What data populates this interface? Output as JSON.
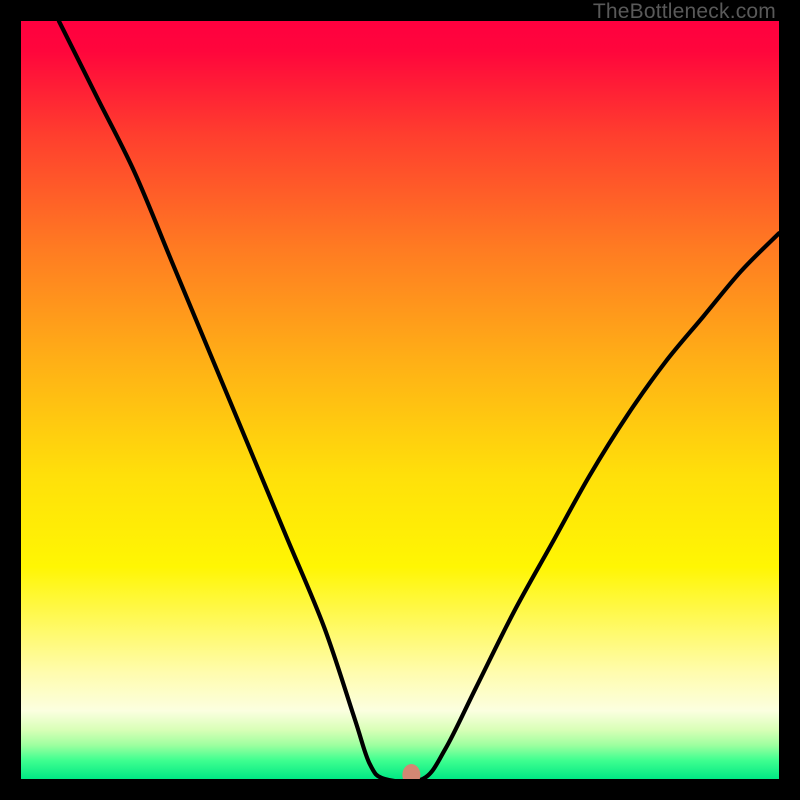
{
  "watermark": "TheBottleneck.com",
  "chart_data": {
    "type": "line",
    "title": "",
    "xlabel": "",
    "ylabel": "",
    "xlim": [
      0,
      100
    ],
    "ylim": [
      0,
      100
    ],
    "description": "Bottleneck magnitude curve: high on both edges, dips near zero around x≈51 (optimal point marked in salmon).",
    "curve": [
      {
        "x": 5,
        "y": 100
      },
      {
        "x": 10,
        "y": 90
      },
      {
        "x": 15,
        "y": 80
      },
      {
        "x": 20,
        "y": 68
      },
      {
        "x": 25,
        "y": 56
      },
      {
        "x": 30,
        "y": 44
      },
      {
        "x": 35,
        "y": 32
      },
      {
        "x": 40,
        "y": 20
      },
      {
        "x": 44,
        "y": 8
      },
      {
        "x": 46,
        "y": 2
      },
      {
        "x": 48,
        "y": 0
      },
      {
        "x": 53,
        "y": 0
      },
      {
        "x": 56,
        "y": 4
      },
      {
        "x": 60,
        "y": 12
      },
      {
        "x": 65,
        "y": 22
      },
      {
        "x": 70,
        "y": 31
      },
      {
        "x": 75,
        "y": 40
      },
      {
        "x": 80,
        "y": 48
      },
      {
        "x": 85,
        "y": 55
      },
      {
        "x": 90,
        "y": 61
      },
      {
        "x": 95,
        "y": 67
      },
      {
        "x": 100,
        "y": 72
      }
    ],
    "optimal_point": {
      "x": 51.5,
      "y": 0
    },
    "gradient_stops": [
      {
        "offset": 0.0,
        "color": "#ff003f"
      },
      {
        "offset": 0.04,
        "color": "#ff063c"
      },
      {
        "offset": 0.15,
        "color": "#ff3e2e"
      },
      {
        "offset": 0.3,
        "color": "#ff7b22"
      },
      {
        "offset": 0.45,
        "color": "#ffb016"
      },
      {
        "offset": 0.6,
        "color": "#ffe00a"
      },
      {
        "offset": 0.72,
        "color": "#fff603"
      },
      {
        "offset": 0.86,
        "color": "#fffcae"
      },
      {
        "offset": 0.91,
        "color": "#fbffe0"
      },
      {
        "offset": 0.935,
        "color": "#d9ffb7"
      },
      {
        "offset": 0.955,
        "color": "#9fffa0"
      },
      {
        "offset": 0.975,
        "color": "#40ff90"
      },
      {
        "offset": 1.0,
        "color": "#00e884"
      }
    ],
    "marker_color": "#d38773",
    "curve_color": "#000000"
  }
}
